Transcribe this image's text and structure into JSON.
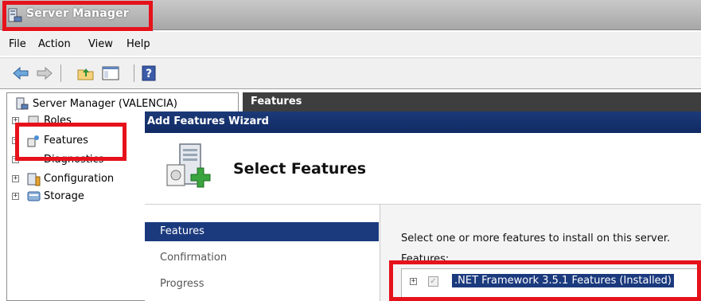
{
  "window": {
    "title": "Server Manager"
  },
  "menu": {
    "items": [
      "File",
      "Action",
      "View",
      "Help"
    ]
  },
  "toolbar": {
    "buttons": [
      "back-arrow-icon",
      "forward-arrow-icon",
      "up-folder-icon",
      "show-hide-console-tree-icon",
      "help-icon"
    ]
  },
  "tree": {
    "root": "Server Manager (VALENCIA)",
    "nodes": [
      {
        "label": "Roles",
        "icon": "roles-icon"
      },
      {
        "label": "Features",
        "icon": "features-icon"
      },
      {
        "label": "Diagnostics",
        "icon": "diagnostics-icon"
      },
      {
        "label": "Configuration",
        "icon": "configuration-icon"
      },
      {
        "label": "Storage",
        "icon": "storage-icon"
      }
    ]
  },
  "right_header": {
    "title": "Features"
  },
  "wizard": {
    "title": "Add Features Wizard",
    "banner_title": "Select Features",
    "nav": [
      {
        "label": "Features",
        "active": true
      },
      {
        "label": "Confirmation",
        "active": false
      },
      {
        "label": "Progress",
        "active": false
      }
    ],
    "instruction": "Select one or more features to install on this server.",
    "features_label": "Features:",
    "feature_items": [
      {
        "label": ".NET Framework 3.5.1 Features  (Installed)",
        "checked": true,
        "expandable": true
      }
    ]
  },
  "colors": {
    "highlight_red": "#e5121c",
    "selection_blue": "#1b3a7e",
    "wizard_title_bg": "#102a63"
  }
}
